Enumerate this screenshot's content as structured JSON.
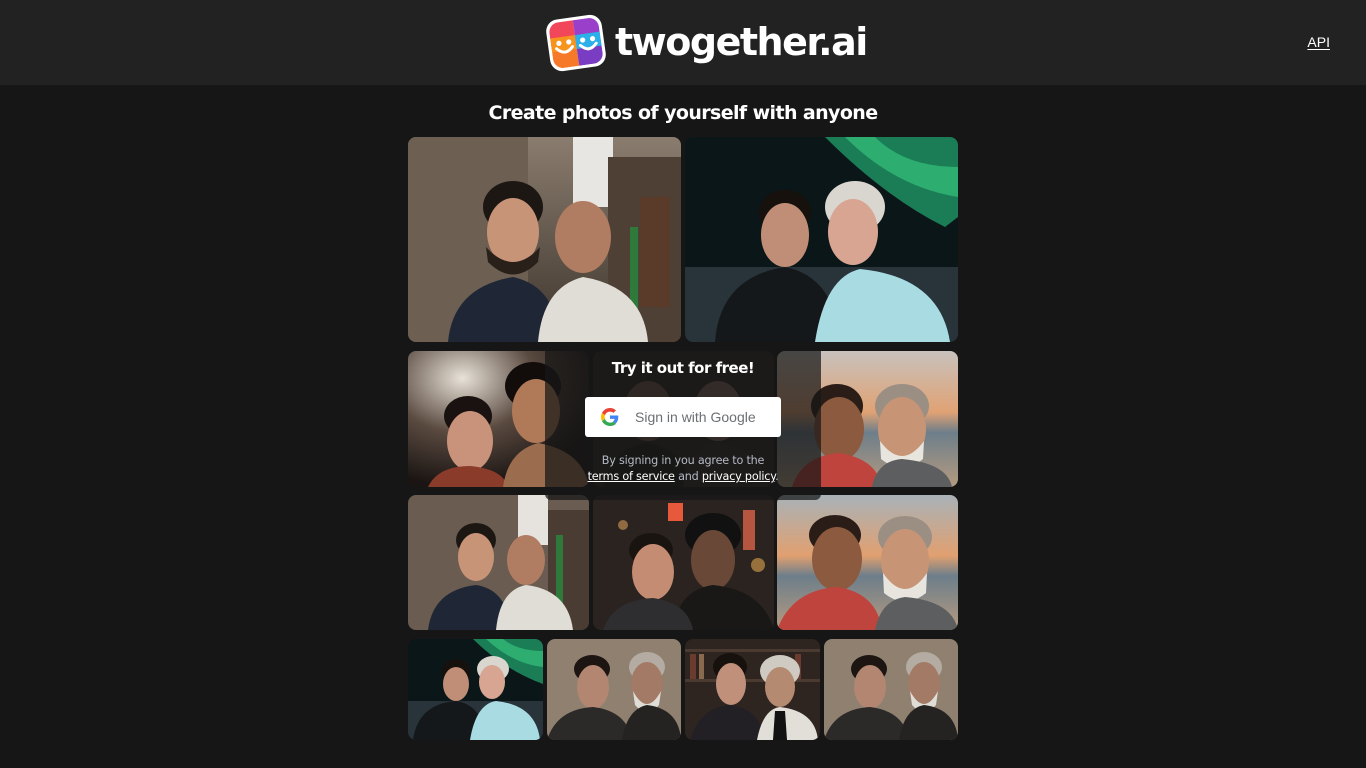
{
  "header": {
    "logo_text": "twogether.ai",
    "logo_icon": "smiley-faces-icon",
    "api_link": "API"
  },
  "main": {
    "title": "Create photos of yourself with anyone",
    "gallery": [
      {
        "row": 1,
        "scene": "old-town-street",
        "companion": "bald elder in white shawl with round glasses"
      },
      {
        "row": 1,
        "scene": "northern-lights-night",
        "companion": "white-haired man in light blue shirt"
      },
      {
        "row": 2,
        "scene": "boxing-gym",
        "companion": "martial artist"
      },
      {
        "row": 2,
        "scene": "hidden-behind-signin-panel",
        "companion": ""
      },
      {
        "row": 2,
        "scene": "beach-sunset",
        "companion": "smiling man in red shirt and white-bearded man"
      },
      {
        "row": 3,
        "scene": "old-town-street",
        "companion": "bald elder in white shawl"
      },
      {
        "row": 3,
        "scene": "city-night-neon",
        "companion": "musician with curly hair in leather jacket"
      },
      {
        "row": 3,
        "scene": "beach-sunset",
        "companion": "smiling man in red shirt and white-bearded man"
      },
      {
        "row": 4,
        "scene": "northern-lights-night",
        "companion": "white-haired man in light blue shirt"
      },
      {
        "row": 4,
        "scene": "sepia-portrait-studio",
        "companion": "white-bearded man in dark suit"
      },
      {
        "row": 4,
        "scene": "library-bookshelves",
        "companion": "white-haired mustached man in white jacket"
      },
      {
        "row": 4,
        "scene": "sepia-portrait-studio",
        "companion": "white-bearded man in dark suit"
      }
    ]
  },
  "signin": {
    "title": "Try it out for free!",
    "button_label": "Sign in with Google",
    "button_icon": "google-g-icon",
    "legal_prefix": "By signing in you agree to the",
    "terms_link": "terms of service",
    "legal_and": "and",
    "privacy_link": "privacy policy",
    "legal_suffix": "."
  },
  "colors": {
    "page_bg": "#161616",
    "header_bg": "#222222",
    "text": "#ffffff",
    "legal_text": "#b4b9c4",
    "google_label": "#6b6f73"
  }
}
